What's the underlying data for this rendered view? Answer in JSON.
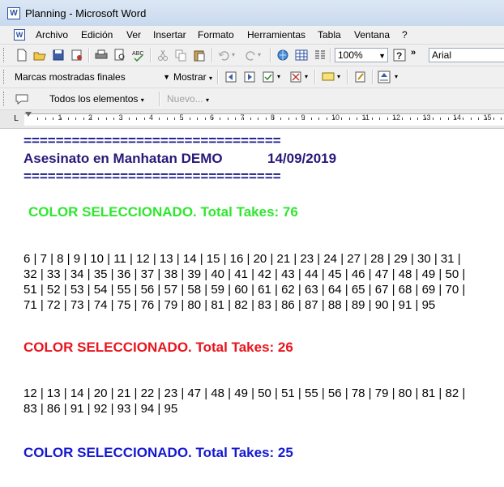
{
  "window": {
    "title": "Planning - Microsoft Word",
    "app_icon_letter": "W"
  },
  "menu": {
    "items": [
      "Archivo",
      "Edición",
      "Ver",
      "Insertar",
      "Formato",
      "Herramientas",
      "Tabla",
      "Ventana",
      "?"
    ]
  },
  "toolbar1": {
    "zoom": "100%",
    "font": "Arial",
    "icons": [
      "new-document-icon",
      "open-icon",
      "save-icon",
      "permission-icon",
      "print-icon",
      "print-preview-icon",
      "spelling-icon",
      "cut-icon",
      "copy-icon",
      "paste-icon",
      "undo-icon",
      "redo-icon",
      "hyperlink-icon",
      "table-icon",
      "columns-icon",
      "help-icon"
    ]
  },
  "toolbar2": {
    "display_mode": "Marcas mostradas finales",
    "show_label": "Mostrar"
  },
  "toolbar3": {
    "all_elements": "Todos los elementos",
    "new_label": "Nuevo..."
  },
  "ruler": {
    "numbers": [
      "1",
      "2",
      "3",
      "4",
      "5",
      "6",
      "7",
      "8",
      "9",
      "10",
      "11",
      "12",
      "13",
      "14",
      "15"
    ]
  },
  "document": {
    "separator": "================================",
    "header_title": "Asesinato en Manhatan DEMO",
    "header_date": "14/09/2019",
    "section1": {
      "heading": "COLOR SELECCIONADO. Total Takes: 76",
      "lines": [
        " 6 | 7 | 8 | 9 | 10 | 11 | 12 | 13 | 14 | 15 | 16 | 20 | 21 | 23 | 24 | 27 | 28 | 29 | 30 | 31 |",
        "32 | 33 | 34 | 35 | 36 | 37 | 38 | 39 | 40 | 41 | 42 | 43 | 44 | 45 | 46 | 47 | 48 | 49 | 50 |",
        "51 | 52 | 53 | 54 | 55 | 56 | 57 | 58 | 59 | 60 | 61 | 62 | 63 | 64 | 65 | 67 | 68 | 69 | 70 |",
        "71 | 72 | 73 | 74 | 75 | 76 | 79 | 80 | 81 | 82 | 83 | 86 | 87 | 88 | 89 | 90 | 91 | 95"
      ]
    },
    "section2": {
      "heading": "COLOR SELECCIONADO. Total Takes: 26",
      "lines": [
        " 12 | 13 | 14 | 20 | 21 | 22 | 23 | 47 | 48 | 49 | 50 | 51 | 55 | 56 | 78 | 79 | 80 | 81 | 82 |",
        "83 | 86 | 91 | 92 | 93 | 94 | 95"
      ]
    },
    "section3": {
      "heading": "COLOR SELECCIONADO. Total Takes: 25"
    }
  },
  "colors": {
    "green": "#2ee82e",
    "red": "#e8141e",
    "blue": "#1418d0",
    "header": "#2a1878"
  }
}
